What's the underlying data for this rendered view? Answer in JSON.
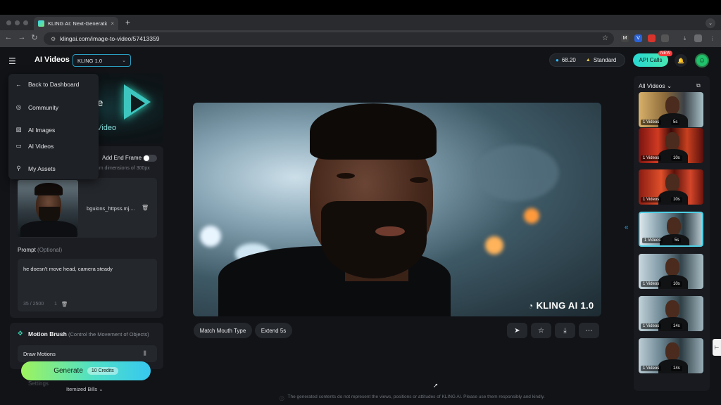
{
  "browser": {
    "tab_title": "KLING AI: Next-Generation A",
    "tab_close": "×",
    "new_tab": "+",
    "url": "klingai.com/image-to-video/57413359",
    "ext_labels": [
      "M",
      "V",
      "",
      "",
      ""
    ]
  },
  "header": {
    "app_title": "AI Videos",
    "model_select": "KLING 1.0",
    "credits": "68.20",
    "plan": "Standard",
    "api_calls": "API Calls",
    "new_badge": "NEW"
  },
  "nav_menu": {
    "items": [
      {
        "label": "Back to Dashboard",
        "icon": "arrow-left-icon"
      },
      {
        "label": "Community",
        "icon": "compass-icon"
      },
      {
        "label": "AI Images",
        "icon": "image-icon"
      },
      {
        "label": "AI Videos",
        "icon": "video-icon"
      },
      {
        "label": "My Assets",
        "icon": "user-icon"
      }
    ]
  },
  "hero": {
    "line1": "e",
    "line2": "o Video"
  },
  "image_panel": {
    "end_frame_label": "Add End Frame",
    "min_dim_hint": "num dimensions of 300px",
    "file_name": "bguions_httpss.mj...."
  },
  "prompt": {
    "label": "Prompt",
    "optional": "(Optional)",
    "text": "he doesn't move head, camera steady",
    "char_count": "35 / 2500",
    "count_one": "1"
  },
  "motion_brush": {
    "title": "Motion Brush",
    "subtitle": "(Control the Movement of Objects)",
    "draw_label": "Draw Motions"
  },
  "generate": {
    "label": "Generate",
    "credits": "10 Credits",
    "settings_ghost": "Settings",
    "itemized_bills": "Itemized Bills"
  },
  "video": {
    "watermark": "KLING AI 1.0"
  },
  "video_actions": {
    "match_mouth": "Match Mouth Type",
    "extend": "Extend 5s"
  },
  "right_panel": {
    "title": "All Videos",
    "thumbnails": [
      {
        "count": "1 Videos",
        "duration": "5s",
        "bg": "linear-gradient(90deg,#d9b16a,#8d6b3b 40%,#3b4147 70%,#a8c2c9)"
      },
      {
        "count": "1 Videos",
        "duration": "10s",
        "bg": "linear-gradient(90deg,#7a1410,#d13a22 30%,#3a0b08 50%,#c9401f 75%,#5a0f0c)"
      },
      {
        "count": "1 Videos",
        "duration": "10s",
        "bg": "linear-gradient(90deg,#8a1c12,#e0502a 35%,#5c120b 55%,#d3462a 80%,#6d140d)"
      },
      {
        "count": "1 Videos",
        "duration": "5s",
        "bg": "linear-gradient(90deg,#d8e6ec,#6e8a97 40%,#2a3940 70%,#b5c7ce)"
      },
      {
        "count": "1 Videos",
        "duration": "10s",
        "bg": "linear-gradient(90deg,#c8d8df,#7d96a2 35%,#33434b 65%,#a9bec6)"
      },
      {
        "count": "1 Videos",
        "duration": "14s",
        "bg": "linear-gradient(90deg,#c1d2d9,#6f8995 35%,#2f3f46 65%,#9fb4bd)"
      },
      {
        "count": "1 Videos",
        "duration": "14s",
        "bg": "linear-gradient(90deg,#bccdd5,#6a8490 35%,#2c3b42 65%,#98adb6)"
      }
    ]
  },
  "footer": {
    "disclaimer": "The generated contents do not represent the views, positions or attitudes of KLING AI. Please use them responsibly and kindly."
  }
}
